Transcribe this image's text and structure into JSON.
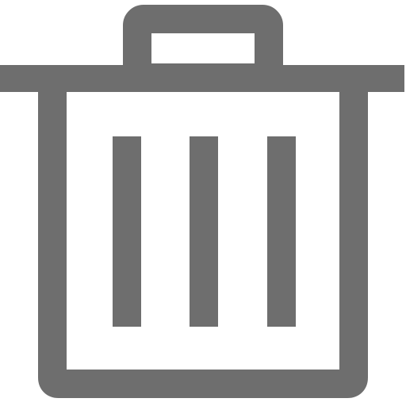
{
  "icon": {
    "name": "trash-icon",
    "color": "#6e6e6e",
    "background": "#ffffff"
  }
}
